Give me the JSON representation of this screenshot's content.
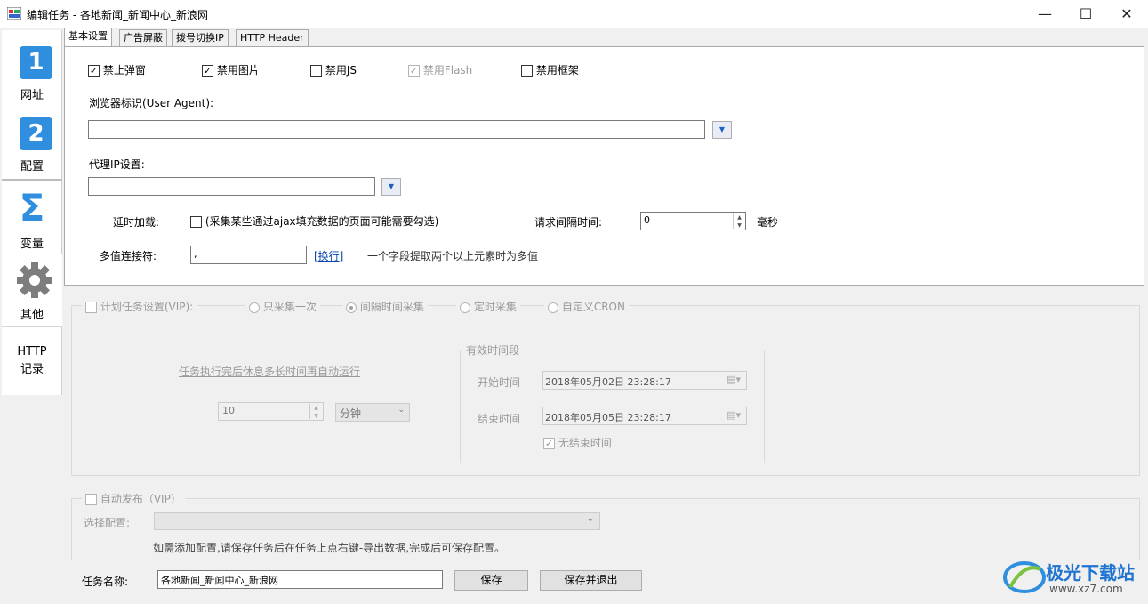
{
  "window": {
    "title": "编辑任务 - 各地新闻_新闻中心_新浪网",
    "minimize": "—",
    "maximize": "☐",
    "close": "✕"
  },
  "sidebar": {
    "items": [
      {
        "label": "网址",
        "icon": "1"
      },
      {
        "label": "配置",
        "icon": "2"
      },
      {
        "label": "变量",
        "icon": "Σ"
      },
      {
        "label": "其他",
        "icon": "gear"
      },
      {
        "label": "HTTP\n记录"
      }
    ]
  },
  "tabs": [
    "基本设置",
    "广告屏蔽",
    "拨号切换IP",
    "HTTP Header"
  ],
  "basic": {
    "checks": [
      {
        "label": "禁止弹窗",
        "checked": true
      },
      {
        "label": "禁用图片",
        "checked": true
      },
      {
        "label": "禁用JS",
        "checked": false
      },
      {
        "label": "禁用Flash",
        "checked": true,
        "disabled": true
      },
      {
        "label": "禁用框架",
        "checked": false
      }
    ],
    "ua_label": "浏览器标识(User Agent):",
    "ua_value": "",
    "proxy_label": "代理IP设置:",
    "proxy_value": "",
    "delay_label": "延时加载:",
    "delay_hint": "(采集某些通过ajax填充数据的页面可能需要勾选)",
    "interval_label": "请求间隔时间:",
    "interval_value": "0",
    "interval_unit": "毫秒",
    "multi_label": "多值连接符:",
    "multi_value": ",",
    "multi_link": "[换行]",
    "multi_hint": "一个字段提取两个以上元素时为多值"
  },
  "schedule": {
    "title": "计划任务设置(VIP):",
    "options": [
      "只采集一次",
      "间隔时间采集",
      "定时采集",
      "自定义CRON"
    ],
    "rest_label": "任务执行完后休息多长时间再自动运行",
    "rest_value": "10",
    "rest_unit": "分钟",
    "valid_title": "有效时间段",
    "start_label": "开始时间",
    "start_value": "2018年05月02日  23:28:17",
    "end_label": "结束时间",
    "end_value": "2018年05月05日  23:28:17",
    "no_end_label": "无结束时间"
  },
  "publish": {
    "title": "自动发布（VIP）",
    "select_label": "选择配置:",
    "select_value": "",
    "hint": "如需添加配置,请保存任务后在任务上点右键-导出数据,完成后可保存配置。"
  },
  "footer": {
    "name_label": "任务名称:",
    "name_value": "各地新闻_新闻中心_新浪网",
    "save": "保存",
    "save_exit": "保存并退出"
  },
  "watermark": {
    "text": "极光下载站",
    "url": "www.xz7.com"
  },
  "colors": {
    "accent": "#2f8fde",
    "link": "#0645ad"
  }
}
